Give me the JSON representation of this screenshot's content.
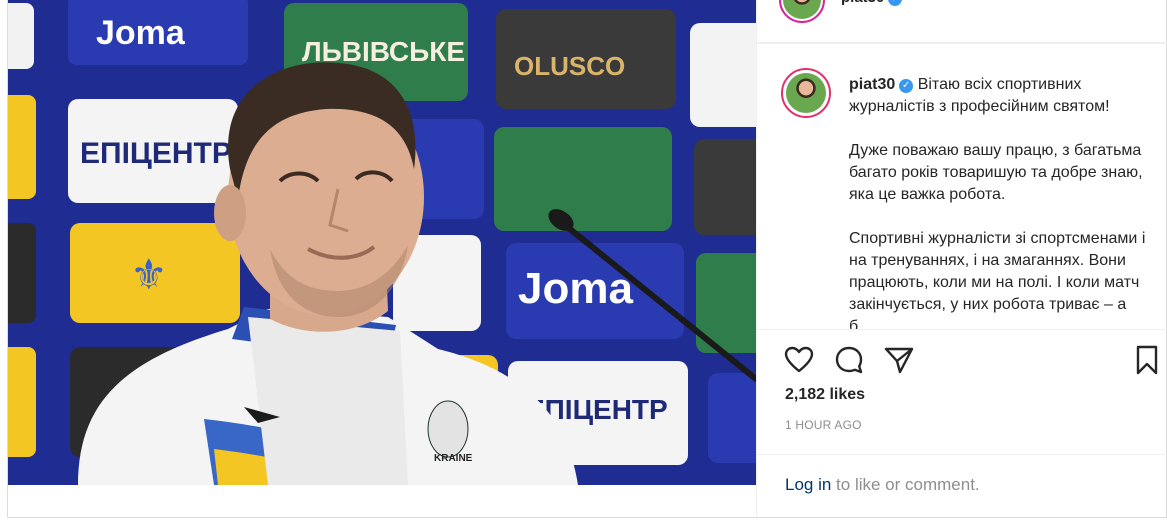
{
  "header": {
    "username": "piat30"
  },
  "caption": {
    "username": "piat30",
    "paragraphs": [
      "Вітаю всіх спортивних журналістів з професійним святом!",
      "Дуже поважаю вашу працю, з багатьма багато років товаришую та добре знаю, яка це важка робота.",
      "Спортивні журналісти зі спортсменами і на тренуваннях, і на змаганнях. Вони працюють, коли ми на полі. І коли матч закінчується, у них робота триває – а б...",
      ""
    ]
  },
  "stats": {
    "likes": "2,182 likes",
    "time_ago": "1 HOUR AGO"
  },
  "login": {
    "link_text": "Log in",
    "rest_text": " to like or comment."
  },
  "photo": {
    "sponsors": [
      "Joma",
      "ЛЬВІВСЬКЕ",
      "OLUSCO",
      "ЕПІЦЕНТР",
      "Joma",
      "ЛЬВІВСЬКЕ",
      "ЕПІЦЕНТР",
      "UKRAINE"
    ]
  },
  "colors": {
    "accent": "#3897f0",
    "link": "#00376b",
    "muted": "#8e8e8e",
    "board_blue": "#1d2a8c"
  },
  "icons": [
    "heart-icon",
    "comment-icon",
    "share-icon",
    "bookmark-icon",
    "verified-badge-icon"
  ]
}
